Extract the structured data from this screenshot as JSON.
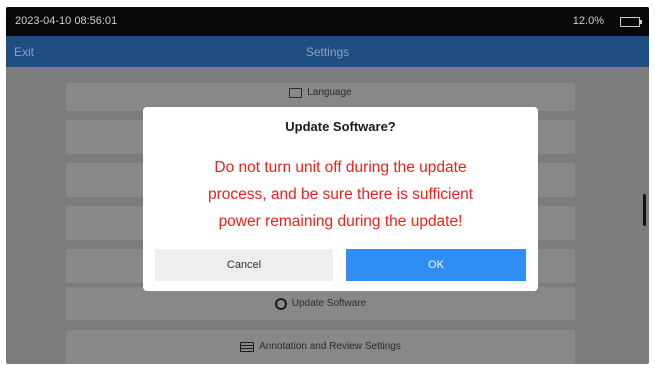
{
  "status_bar": {
    "datetime": "2023-04-10 08:56:01",
    "battery_text": "12.0%",
    "battery_icon": "battery-icon"
  },
  "title_bar": {
    "back_label": "Exit",
    "title": "Settings"
  },
  "menu": {
    "items": [
      {
        "label": "Language",
        "icon": "language-icon"
      },
      {
        "label": "",
        "icon": ""
      },
      {
        "label": "",
        "icon": ""
      },
      {
        "label": "",
        "icon": ""
      },
      {
        "label": "",
        "icon": ""
      },
      {
        "label": "Update Software",
        "icon": "update-icon"
      },
      {
        "label": "Annotation and Review Settings",
        "icon": "annotation-icon"
      }
    ]
  },
  "dialog": {
    "title": "Update Software?",
    "message_lines": [
      "Do not turn unit off during the update",
      "process, and be sure there is sufficient",
      "power remaining during the update!"
    ],
    "cancel_label": "Cancel",
    "ok_label": "OK",
    "ok_color": "#2f8ef3",
    "message_color": "#e8231d"
  }
}
